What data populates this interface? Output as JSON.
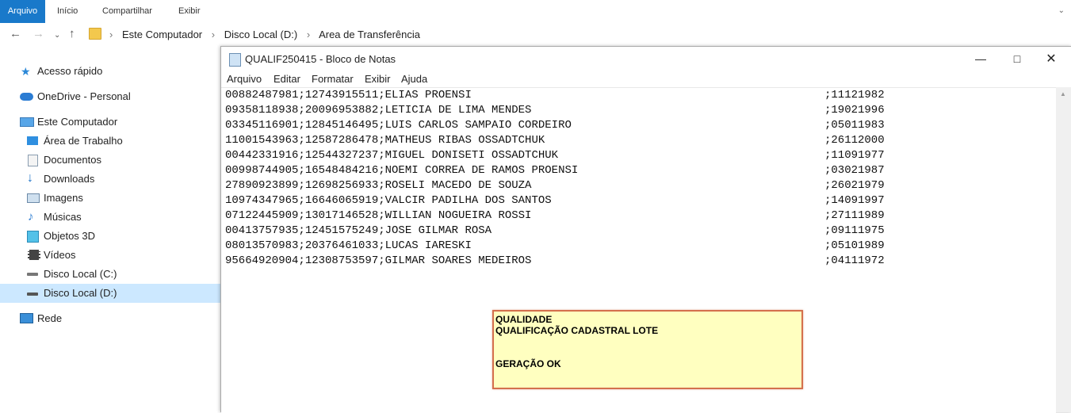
{
  "ribbon": {
    "tabs": [
      "Arquivo",
      "Início",
      "Compartilhar",
      "Exibir"
    ]
  },
  "address": {
    "crumbs": [
      "Este Computador",
      "Disco Local (D:)",
      "Area de Transferência"
    ]
  },
  "sidebar": {
    "items": [
      {
        "label": "Acesso rápido",
        "icon": "star-icon"
      },
      {
        "label": "OneDrive - Personal",
        "icon": "cloud-icon"
      },
      {
        "label": "Este Computador",
        "icon": "computer-icon"
      },
      {
        "label": "Área de Trabalho",
        "icon": "desktop-icon"
      },
      {
        "label": "Documentos",
        "icon": "documents-icon"
      },
      {
        "label": "Downloads",
        "icon": "download-icon"
      },
      {
        "label": "Imagens",
        "icon": "pictures-icon"
      },
      {
        "label": "Músicas",
        "icon": "music-icon"
      },
      {
        "label": "Objetos 3D",
        "icon": "cube-icon"
      },
      {
        "label": "Vídeos",
        "icon": "video-icon"
      },
      {
        "label": "Disco Local (C:)",
        "icon": "drive-icon"
      },
      {
        "label": "Disco Local (D:)",
        "icon": "drive-icon",
        "selected": true
      },
      {
        "label": "Rede",
        "icon": "network-icon"
      }
    ]
  },
  "notepad": {
    "title": "QUALIF250415 - Bloco de Notas",
    "menu": [
      "Arquivo",
      "Editar",
      "Formatar",
      "Exibir",
      "Ajuda"
    ],
    "lines": [
      {
        "text": "00882487981;12743915511;ELIAS PROENSI",
        "date": ";11121982"
      },
      {
        "text": "09358118938;20096953882;LETICIA DE LIMA MENDES",
        "date": ";19021996"
      },
      {
        "text": "03345116901;12845146495;LUIS CARLOS SAMPAIO CORDEIRO",
        "date": ";05011983"
      },
      {
        "text": "11001543963;12587286478;MATHEUS RIBAS OSSADTCHUK",
        "date": ";26112000"
      },
      {
        "text": "00442331916;12544327237;MIGUEL DONISETI OSSADTCHUK",
        "date": ";11091977"
      },
      {
        "text": "00998744905;16548484216;NOEMI CORREA DE RAMOS PROENSI",
        "date": ";03021987"
      },
      {
        "text": "27890923899;12698256933;ROSELI MACEDO DE SOUZA",
        "date": ";26021979"
      },
      {
        "text": "10974347965;16646065919;VALCIR PADILHA DOS SANTOS",
        "date": ";14091997"
      },
      {
        "text": "07122445909;13017146528;WILLIAN NOGUEIRA ROSSI",
        "date": ";27111989"
      },
      {
        "text": "00413757935;12451575249;JOSE GILMAR ROSA",
        "date": ";09111975"
      },
      {
        "text": "08013570983;20376461033;LUCAS IARESKI",
        "date": ";05101989"
      },
      {
        "text": "95664920904;12308753597;GILMAR SOARES MEDEIROS",
        "date": ";04111972"
      }
    ]
  },
  "note": {
    "line1": "QUALIDADE",
    "line2": "QUALIFICAÇÃO CADASTRAL LOTE",
    "line3": "GERAÇÃO OK"
  },
  "colors": {
    "ribbon_file_bg": "#1979ca",
    "selected_bg": "#cce8ff",
    "note_bg": "#ffffc0",
    "note_border": "#d4704d"
  }
}
